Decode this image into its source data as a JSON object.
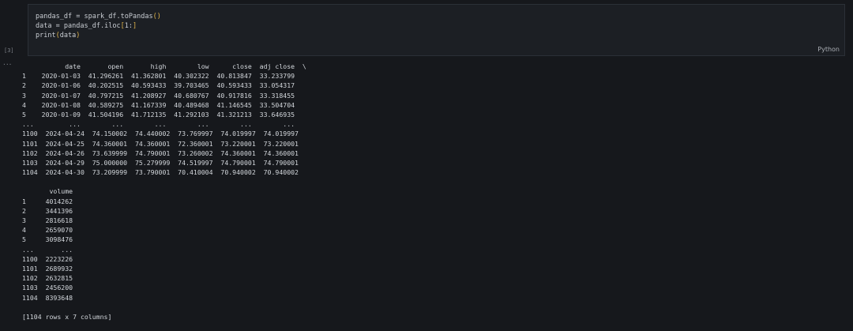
{
  "cell": {
    "execution_count": "[3]",
    "language": "Python",
    "code_lines": [
      "pandas_df = spark_df.toPandas()",
      "data = pandas_df.iloc[1:]",
      "print(data)"
    ]
  },
  "output": {
    "menu_icon": "ellipsis-icon",
    "menu_glyph": "...",
    "lines": [
      "           date       open       high        low      close  adj close  \\",
      "1    2020-01-03  41.296261  41.362801  40.302322  40.813847  33.233799",
      "2    2020-01-06  40.202515  40.593433  39.703465  40.593433  33.054317",
      "3    2020-01-07  40.797215  41.208927  40.680767  40.917816  33.318455",
      "4    2020-01-08  40.589275  41.167339  40.489468  41.146545  33.504704",
      "5    2020-01-09  41.504196  41.712135  41.292103  41.321213  33.646935",
      "...         ...        ...        ...        ...        ...        ...",
      "1100  2024-04-24  74.150002  74.440002  73.769997  74.019997  74.019997",
      "1101  2024-04-25  74.360001  74.360001  72.360001  73.220001  73.220001",
      "1102  2024-04-26  73.639999  74.790001  73.260002  74.360001  74.360001",
      "1103  2024-04-29  75.000000  75.279999  74.519997  74.790001  74.790001",
      "1104  2024-04-30  73.209999  73.790001  70.410004  70.940002  70.940002",
      "",
      "       volume",
      "1     4014262",
      "2     3441396",
      "3     2816618",
      "4     2659070",
      "5     3098476",
      "...       ...",
      "1100  2223226",
      "1101  2689932",
      "1102  2632815",
      "1103  2456200",
      "1104  8393648",
      "",
      "[1104 rows x 7 columns]"
    ]
  }
}
